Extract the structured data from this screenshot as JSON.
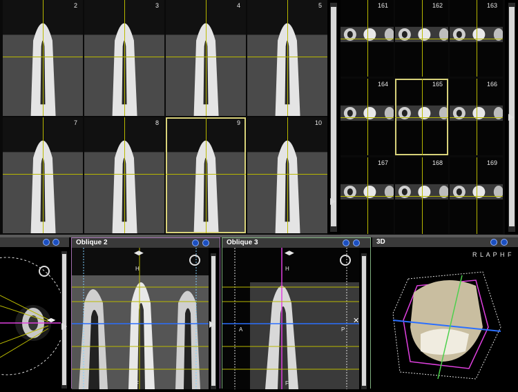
{
  "axial_grid": {
    "cells": [
      "2",
      "3",
      "4",
      "5",
      "7",
      "8",
      "9",
      "10"
    ]
  },
  "cross_grid": {
    "cells": [
      "161",
      "162",
      "163",
      "164",
      "165",
      "166",
      "167",
      "168",
      "169"
    ]
  },
  "panels": {
    "oblique2": {
      "title": "Oblique 2",
      "top_label": "H",
      "bottom_label": "F"
    },
    "oblique3": {
      "title": "Oblique 3",
      "top_label": "H",
      "bottom_label": "F",
      "left_label": "A",
      "right_label": "P"
    },
    "view3d": {
      "title": "3D",
      "orientation": "R L A P H F"
    }
  },
  "colors": {
    "guide": "#b9b900",
    "oblique2_border": "#a36fb0",
    "oblique3_border": "#7fb07f",
    "accent_magenta": "#e040e0",
    "accent_blue": "#2a6fff"
  }
}
